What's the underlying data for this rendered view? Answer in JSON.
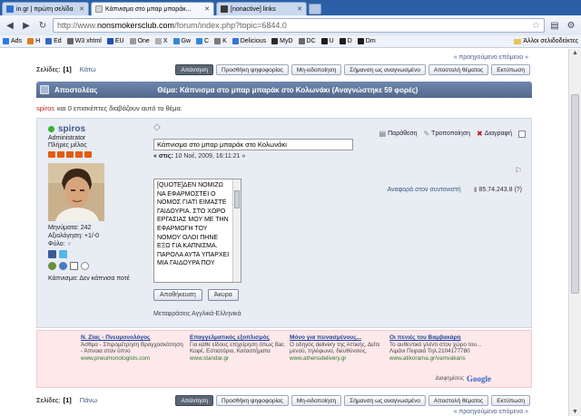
{
  "browser": {
    "tabs": [
      {
        "label": "in.gr | πρώτη σελίδα",
        "color": "#2f6fd0",
        "active": false
      },
      {
        "label": "Κάπνισμα στο μπαρ μπαράκ...",
        "color": "#d7d7d7",
        "active": true
      },
      {
        "label": "[nonactive] links",
        "color": "#3a3a3a",
        "active": false
      }
    ],
    "url_prefix": "http://www.",
    "url_host": "nonsmokersclub.com",
    "url_path": "/forum/index.php?topic=6844.0",
    "bookmarks": [
      {
        "label": "Ads",
        "color": "#2a7be4"
      },
      {
        "label": "H",
        "color": "#e07c24"
      },
      {
        "label": "Ed",
        "color": "#3468c4"
      },
      {
        "label": "W3 xhtml",
        "color": "#666666"
      },
      {
        "label": "EU",
        "color": "#1f4fb3"
      },
      {
        "label": "One",
        "color": "#9b9b9b"
      },
      {
        "label": "X",
        "color": "#b0b0b0"
      },
      {
        "label": "Gw",
        "color": "#3a85d8"
      },
      {
        "label": "C",
        "color": "#3a85d8"
      },
      {
        "label": "K",
        "color": "#7c7c7c"
      },
      {
        "label": "Delicious",
        "color": "#3274d8"
      },
      {
        "label": "MyD",
        "color": "#2b2b2b"
      },
      {
        "label": "DC",
        "color": "#6a6a6a"
      },
      {
        "label": "U",
        "color": "#1e1e1e"
      },
      {
        "label": "D",
        "color": "#1e1e1e"
      },
      {
        "label": "Dm",
        "color": "#1e1e1e"
      }
    ],
    "other_bookmarks": "Άλλοι σελιδοδείκτες"
  },
  "forum": {
    "prev_next": "« προηγούμενο επόμενο »",
    "pages_label": "Σελίδες:",
    "current_page": "[1]",
    "go_down": "Κάτω",
    "go_up": "Πάνω",
    "buttons": [
      "Απάντηση",
      "Προσθήκη ψηφοφορίας",
      "Μη-ειδοποίηση",
      "Σήμανση ως αναγνωσμένο",
      "Αποστολή θέματος",
      "Εκτύπωση"
    ],
    "header_author": "Αποστολέας",
    "header_topic": "Θέμα: Κάπνισμα στο μπαρ μπαράκ στο Κολωνάκι  (Αναγνώστηκε 59 φορές)",
    "viewer_name": "spiros",
    "viewer_text": "και 0 επισκέπτες διαβάζουν αυτό το θέμα."
  },
  "post": {
    "author": "spiros",
    "role": "Administrator",
    "membership": "Πλήρες μέλος",
    "stars": 5,
    "messages": "Μηνύματα: 242",
    "karma": "Αξιολόγηση: +1/-0",
    "gender": "Φύλο:",
    "smoking": "Κάπνισμα: Δεν κάπνισα ποτέ",
    "subject_value": "Κάπνισμα στο μπαρ μπαράκ στο Κολωνάκι",
    "on_label": "« στις:",
    "on_date": "10 Νοέ, 2009, 16:11:21 »",
    "quote": "Παράθεση",
    "modify": "Τροποποίηση",
    "delete": "Διαγραφή",
    "report": "Αναφορά στον συντονιστή",
    "ip": "85.74.243.8 (?)",
    "body": "[quote]ΔΕΝ ΝΟΜΙΖΩ ΝΑ ΕΦΑΡΜΟΣΤΕΙ Ο ΝΟΜΟΣ ΓΙΑΤΙ ΕΙΜΑΣΤΕ ΓΑΙΔΟΥΡΙΑ. ΣΤΟ ΧΩΡΟ ΕΡΓΑΣΙΑΣ ΜΟΥ ΜΕ ΤΗΝ ΕΦΑΡΜΟΓΗ ΤΟΥ ΝΟΜΟΥ ΟΛΟΙ ΠΗΝΕ ΕΞΩ ΓΙΑ ΚΑΠΝΙΣΜΑ. ΠΑΡΟΛΑ ΑΥΤΑ ΥΠΑΡΧΕΙ ΜΙΑ ΓΑΙΔΟΥΡΑ ΠΟΥ",
    "save": "Αποθήκευση",
    "cancel": "Άκυρα",
    "translate": "Μεταφράσεις Αγγλικά-Ελληνικά"
  },
  "ads": [
    {
      "title": "Ν. Ζίας - Πνευμονολόγος",
      "text": "Άσθμα - Σπιρομέτρηση Βρογχοσκόπηση - Άπνοια στον ύπνο",
      "url": "www.pneumonologists.com"
    },
    {
      "title": "Επαγγελματικός εξοπλισμός",
      "text": "Για κάθε είδους επιχείρηση όπως Bar, Καφέ, Εστιατόριο, Καταστήματα",
      "url": "www.standar.gr"
    },
    {
      "title": "Μόνο για πεινασμένους...",
      "text": "Ο οδηγός delivery της Αττικής. Δείτε μενού, τηλέφωνα, διευθύνσεις.",
      "url": "www.athensdelivery.gr"
    },
    {
      "title": "Οι πενιές του Βαμβακάρη",
      "text": "Το αυθεντικό γλέντι στον χώρο του... Λιμάνι Πειραιά Τηλ.2104177780",
      "url": "www.atikorama.gr/vamvakaris"
    }
  ],
  "ads_by": "Διαφημίσεις",
  "ads_brand": "Google"
}
